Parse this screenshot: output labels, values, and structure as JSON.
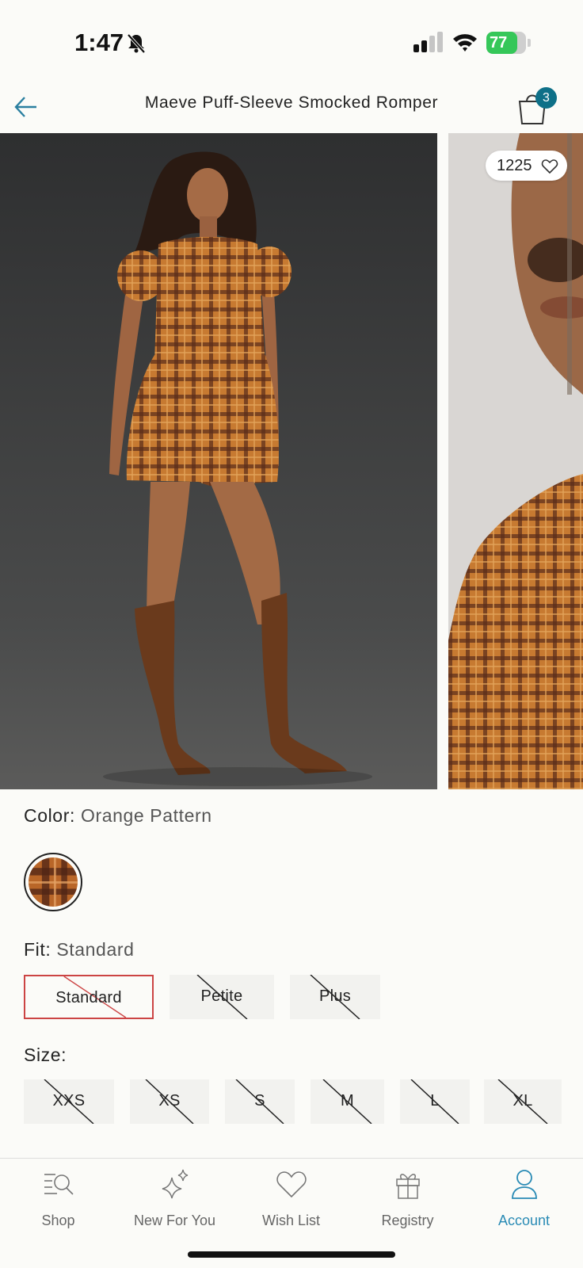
{
  "status_bar": {
    "time": "1:47",
    "battery": "77",
    "battery_level": 0.77,
    "battery_color": "#35c759"
  },
  "header": {
    "title": "Maeve Puff-Sleeve Smocked Romper",
    "cart_count": "3",
    "accent": "#0e7088"
  },
  "gallery": {
    "likes": "1225"
  },
  "color": {
    "label": "Color:",
    "value": "Orange Pattern"
  },
  "fit": {
    "label": "Fit:",
    "value": "Standard",
    "options": [
      {
        "label": "Standard",
        "selected": true,
        "unavailable": true
      },
      {
        "label": "Petite",
        "selected": false,
        "unavailable": true
      },
      {
        "label": "Plus",
        "selected": false,
        "unavailable": true
      }
    ]
  },
  "size": {
    "label": "Size:",
    "options": [
      "XXS",
      "XS",
      "S",
      "M",
      "L",
      "XL"
    ]
  },
  "tabbar": {
    "items": [
      {
        "label": "Shop",
        "icon": "shop-search-icon"
      },
      {
        "label": "New For You",
        "icon": "sparkles-icon"
      },
      {
        "label": "Wish List",
        "icon": "heart-icon"
      },
      {
        "label": "Registry",
        "icon": "gift-icon"
      },
      {
        "label": "Account",
        "icon": "person-icon",
        "active": true
      }
    ],
    "active_color": "#2a8bb5"
  }
}
